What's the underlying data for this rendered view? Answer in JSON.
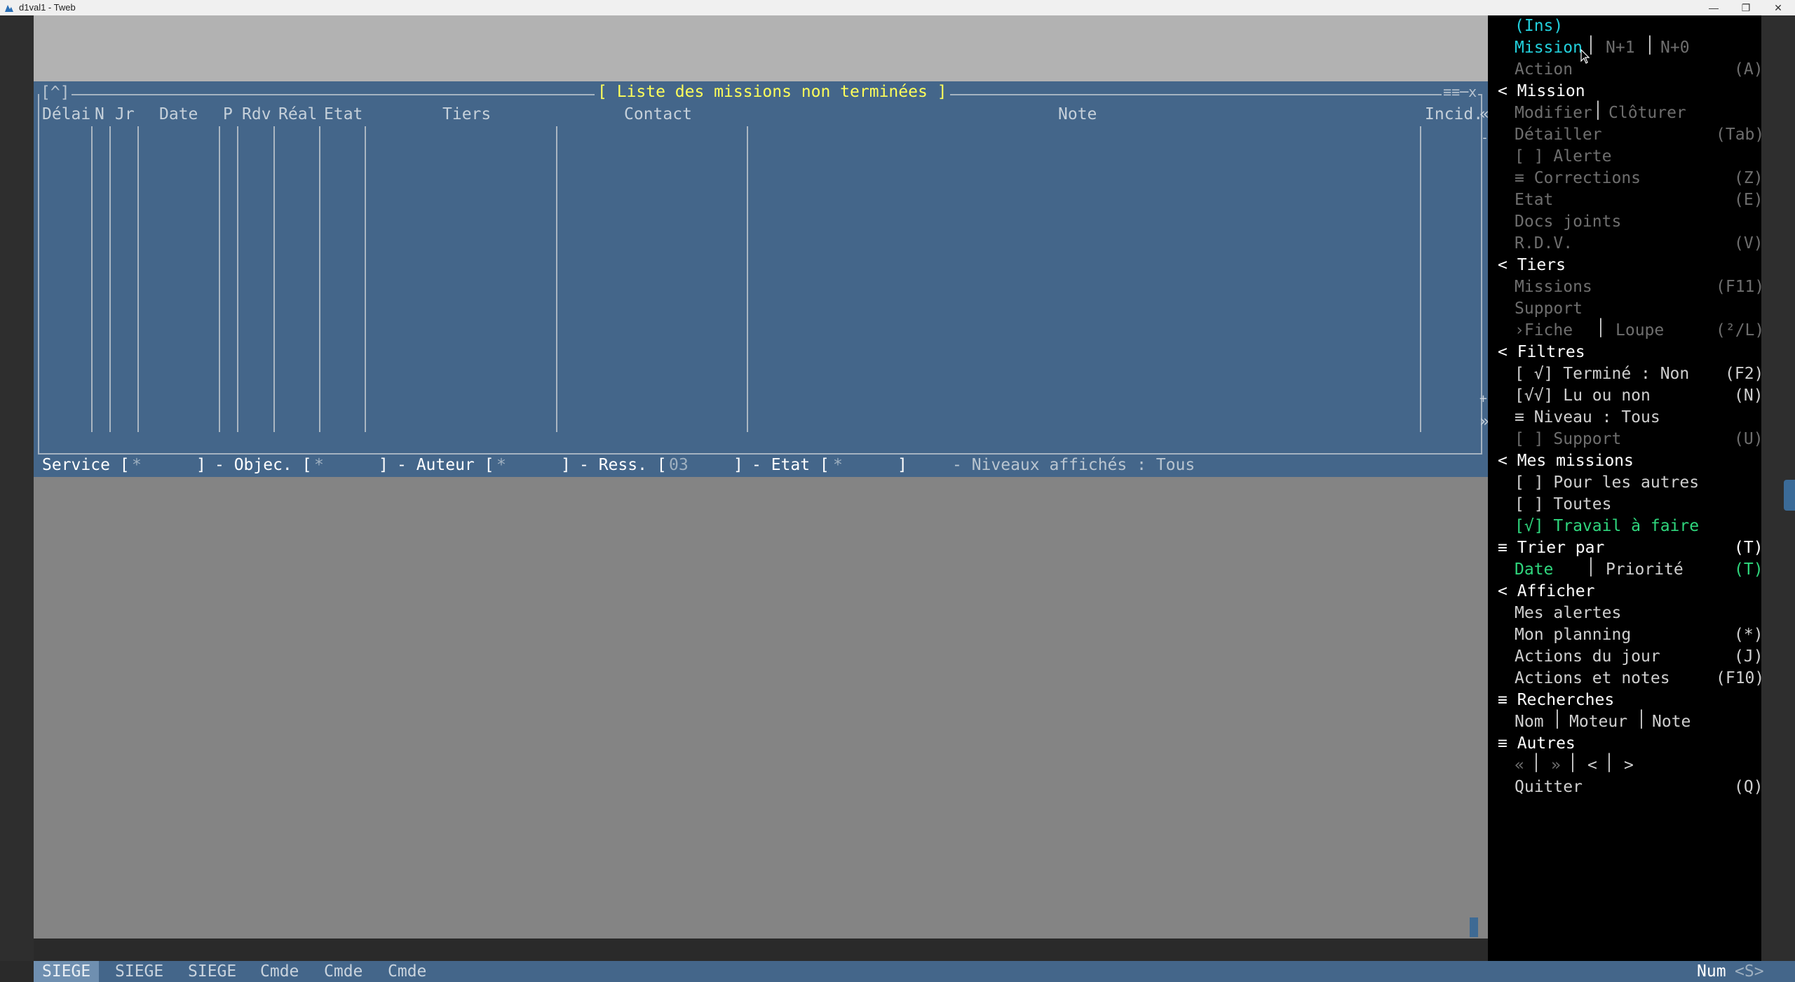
{
  "window": {
    "title": "d1val1 - Tweb",
    "minimize": "—",
    "restore": "❐",
    "close": "✕"
  },
  "missions_window": {
    "title": "[ Liste des missions non terminées ]",
    "corner_left": "[^]",
    "corner_right": "≡≡─x",
    "columns": [
      "Délai",
      "N",
      "Jr",
      "Date",
      "P",
      "Rdv",
      "Réal",
      "Etat",
      "Tiers",
      "Contact",
      "Note",
      "Incid."
    ],
    "side_glyphs": {
      "top": "«",
      "mid1": "-",
      "mid2": "+",
      "bottom": "»"
    }
  },
  "filters": {
    "service_label": "Service [",
    "service_value": "*",
    "service_close": "]",
    "objec_label": "- Objec. [",
    "objec_value": "*",
    "objec_close": "]",
    "auteur_label": "- Auteur [",
    "auteur_value": "*",
    "auteur_close": "]",
    "ress_label": "- Ress. [",
    "ress_value": "03",
    "ress_close": "]",
    "etat_label": "- Etat [",
    "etat_value": "*",
    "etat_close": "]",
    "niveaux": "- Niveaux affichés : Tous"
  },
  "statusbar": {
    "tabs": [
      "SIEGE",
      "SIEGE",
      "SIEGE",
      "Cmde",
      "Cmde",
      "Cmde"
    ],
    "num": "Num",
    "shift": "<S>"
  },
  "menu": {
    "ins": "(Ins)",
    "mission_row": {
      "a": "Mission",
      "b": "N+1",
      "c": "N+0"
    },
    "action": {
      "label": "Action",
      "shortcut": "(A)"
    },
    "mission_header": "< Mission",
    "modifier": "Modifier",
    "cloturer": "Clôturer",
    "detailler": {
      "label": "Détailler",
      "shortcut": "(Tab)"
    },
    "alerte": "[ ] Alerte",
    "corrections": {
      "label": "≡ Corrections",
      "shortcut": "(Z)"
    },
    "etat": {
      "label": "Etat",
      "shortcut": "(E)"
    },
    "docs": "Docs joints",
    "rdv": {
      "label": "R.D.V.",
      "shortcut": "(V)"
    },
    "tiers_header": "< Tiers",
    "missions": {
      "label": "Missions",
      "shortcut": "(F11)"
    },
    "support": "Support",
    "fiche": "›Fiche",
    "loupe": "Loupe",
    "fiche_shortcut": "(²/L)",
    "filtres_header": "< Filtres",
    "termine": {
      "label": "[ √] Terminé : Non",
      "shortcut": "(F2)"
    },
    "lu": {
      "label": "[√√] Lu ou non",
      "shortcut": "(N)"
    },
    "niveau": "≡ Niveau : Tous",
    "support_filter": {
      "label": "[ ] Support",
      "shortcut": "(U)"
    },
    "mes_missions_header": "< Mes missions",
    "pour_autres": "[ ] Pour les autres",
    "toutes": "[ ] Toutes",
    "travail": "[√] Travail à faire",
    "trier_header": {
      "label": "≡ Trier par",
      "shortcut": "(T)"
    },
    "trier_row": {
      "a": "Date",
      "b": "Priorité",
      "shortcut": "(T)"
    },
    "afficher_header": "< Afficher",
    "mes_alertes": "Mes alertes",
    "planning": {
      "label": "Mon planning",
      "shortcut": "(*)"
    },
    "actions_jour": {
      "label": "Actions du jour",
      "shortcut": "(J)"
    },
    "actions_notes": {
      "label": "Actions et notes",
      "shortcut": "(F10)"
    },
    "recherches_header": "≡ Recherches",
    "recherches_row": {
      "a": "Nom",
      "b": "Moteur",
      "c": "Note"
    },
    "autres_header": "≡ Autres",
    "nav": {
      "a": "«",
      "b": "»",
      "c": "<",
      "d": ">"
    },
    "quitter": {
      "label": "Quitter",
      "shortcut": "(Q)"
    }
  }
}
